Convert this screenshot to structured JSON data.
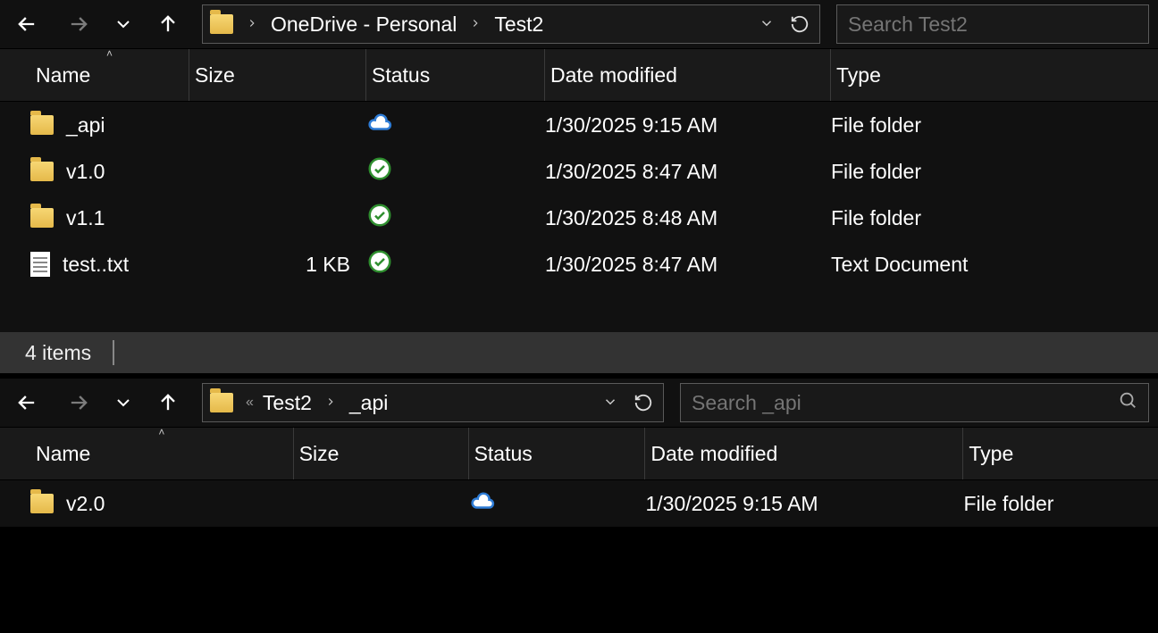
{
  "pane1": {
    "breadcrumb": [
      "OneDrive - Personal",
      "Test2"
    ],
    "search_placeholder": "Search Test2",
    "columns": {
      "name": "Name",
      "size": "Size",
      "status": "Status",
      "date": "Date modified",
      "type": "Type"
    },
    "rows": [
      {
        "icon": "folder",
        "name": "_api",
        "size": "",
        "status": "cloud",
        "date": "1/30/2025 9:15 AM",
        "type": "File folder"
      },
      {
        "icon": "folder",
        "name": "v1.0",
        "size": "",
        "status": "check",
        "date": "1/30/2025 8:47 AM",
        "type": "File folder"
      },
      {
        "icon": "folder",
        "name": "v1.1",
        "size": "",
        "status": "check",
        "date": "1/30/2025 8:48 AM",
        "type": "File folder"
      },
      {
        "icon": "text",
        "name": "test..txt",
        "size": "1 KB",
        "status": "check",
        "date": "1/30/2025 8:47 AM",
        "type": "Text Document"
      }
    ],
    "status_text": "4 items"
  },
  "pane2": {
    "breadcrumb": [
      "Test2",
      "_api"
    ],
    "search_placeholder": "Search _api",
    "columns": {
      "name": "Name",
      "size": "Size",
      "status": "Status",
      "date": "Date modified",
      "type": "Type"
    },
    "rows": [
      {
        "icon": "folder",
        "name": "v2.0",
        "size": "",
        "status": "cloud",
        "date": "1/30/2025 9:15 AM",
        "type": "File folder"
      }
    ]
  }
}
